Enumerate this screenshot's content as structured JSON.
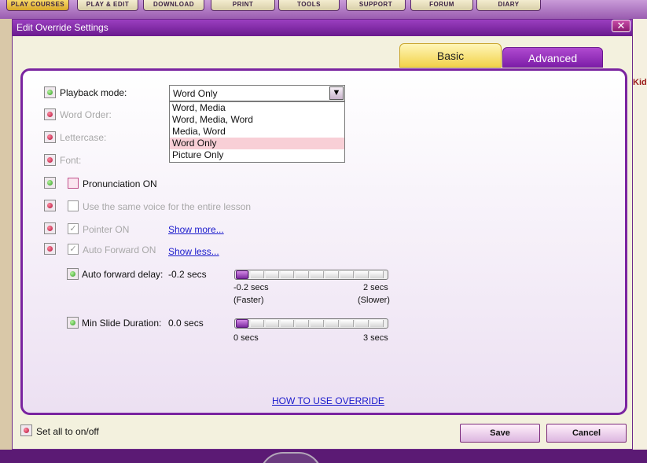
{
  "background": {
    "nav_buttons": [
      {
        "label": "PLAY COURSES",
        "active": true
      },
      {
        "label": "PLAY & EDIT",
        "active": false
      },
      {
        "label": "DOWNLOAD",
        "active": false
      },
      {
        "label": "PRINT",
        "active": false
      },
      {
        "label": "TOOLS",
        "active": false
      },
      {
        "label": "SUPPORT",
        "active": false
      },
      {
        "label": "FORUM",
        "active": false
      },
      {
        "label": "DIARY",
        "active": false
      }
    ],
    "side_fragment_right": "Kid"
  },
  "dialog": {
    "title": "Edit Override Settings",
    "close_label": "✕",
    "tabs": {
      "basic": "Basic",
      "advanced": "Advanced"
    },
    "playback_mode": {
      "label": "Playback mode:",
      "value": "Word Only",
      "options": [
        "Word, Media",
        "Word, Media, Word",
        "Media, Word",
        "Word Only",
        "Picture Only"
      ],
      "selected_index": 3
    },
    "word_order_label": "Word Order:",
    "lettercase_label": "Lettercase:",
    "font_label": "Font:",
    "pronunciation_label": "Pronunciation ON",
    "same_voice_label": "Use the same voice for the entire lesson",
    "pointer_label": "Pointer ON",
    "show_more": "Show more...",
    "auto_forward_label": "Auto Forward ON",
    "show_less": "Show less...",
    "auto_forward_delay": {
      "label": "Auto forward delay:",
      "value": "-0.2 secs",
      "min_label": "-0.2 secs",
      "max_label": "2 secs",
      "min_hint": "(Faster)",
      "max_hint": "(Slower)",
      "level": 0
    },
    "min_slide_duration": {
      "label": "Min Slide Duration:",
      "value": "0.0 secs",
      "min_label": "0 secs",
      "max_label": "3 secs",
      "level": 0
    },
    "howto_link": "HOW TO USE OVERRIDE",
    "set_all_label": "Set all to on/off",
    "save_label": "Save",
    "cancel_label": "Cancel"
  },
  "colors": {
    "accent_purple": "#7a24a0",
    "tab_active_yellow": "#f2d24a",
    "indicator_green": "#2d9a1e",
    "indicator_red": "#b0103a",
    "selected_option": "#f8cfd6"
  }
}
